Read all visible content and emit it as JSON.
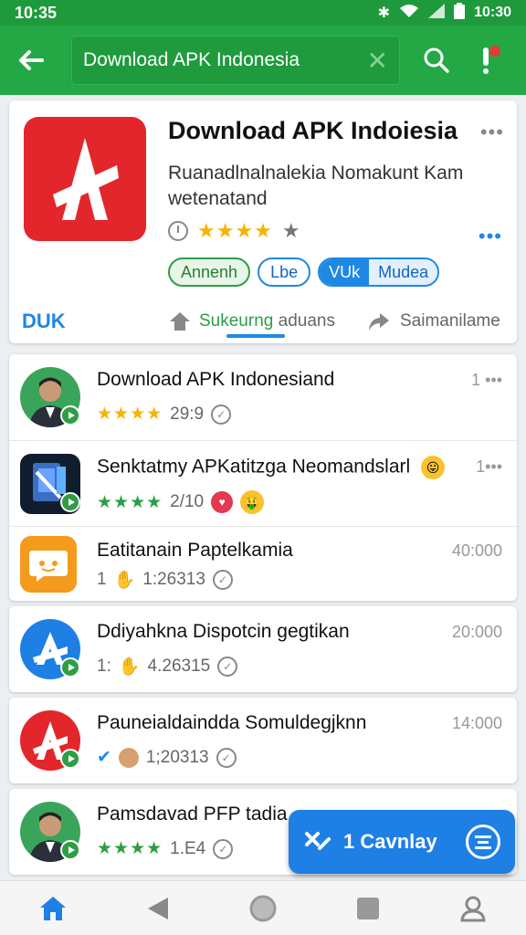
{
  "status_bar": {
    "time_left": "10:35",
    "time_right": "10:30",
    "icons": [
      "bluetooth-icon",
      "wifi-icon",
      "signal-icon",
      "battery-icon"
    ]
  },
  "app_bar": {
    "search_query": "Download APK Indonesia",
    "colors": {
      "bar": "#24a845",
      "accent": "#1e88e5"
    }
  },
  "hero": {
    "title": "Download APK Indoiesia",
    "description": "Ruanadlnalnalekia Nomakunt Kam wetenatand",
    "rating_stars": "★★★★",
    "rating_extra": "★",
    "chips": {
      "green": "Annenh",
      "blue": "Lbe",
      "split_left": "VUk",
      "split_right": "Mudea"
    },
    "brand": "DUK",
    "tab1_icon": "home-up-icon",
    "tab1_label_green": "Sukeurng",
    "tab1_label_grey": "aduans",
    "tab2_label": "Saimanilame"
  },
  "list": [
    {
      "title": "Download APK Indonesiand",
      "stars": "★★★★",
      "meta": "29:9",
      "right": "1 •••",
      "avatar": "person"
    },
    {
      "title": "Senktatmy APKatitzga Neomandslarl",
      "stars": "★★★★",
      "meta": "2/10",
      "right": "1•••",
      "avatar": "tablet"
    },
    {
      "title": "Eatitanain Paptelkamia",
      "meta_prefix": "1",
      "meta": "1:26313",
      "right": "40:000",
      "avatar": "chat"
    },
    {
      "title": "Ddiyahkna Dispotcin gegtikan",
      "meta_prefix": "1:",
      "meta": "4.26315",
      "right": "20:000",
      "avatar": "logo-blue"
    },
    {
      "title": "Pauneialdaindda Somuldegjknn",
      "meta": "1;20313",
      "right": "14:000",
      "avatar": "logo-red"
    },
    {
      "title": "Pamsdavad PFP tadia",
      "stars": "★★★★",
      "meta": "1.E4",
      "avatar": "person"
    }
  ],
  "fab": {
    "label": "1 Cavnlay"
  },
  "bottom_nav": [
    "home-icon",
    "back-icon",
    "circle-home-icon",
    "recents-icon",
    "profile-icon"
  ]
}
